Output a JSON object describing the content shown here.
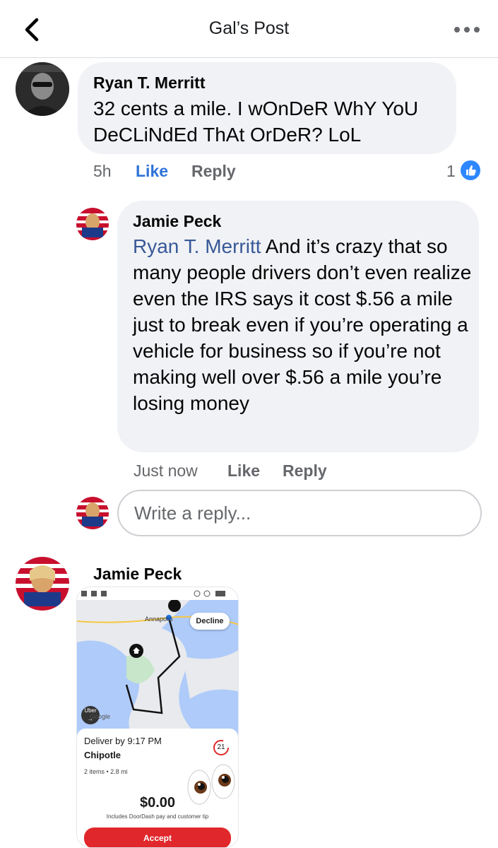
{
  "header": {
    "title": "Gal’s Post"
  },
  "comments": [
    {
      "author": "Ryan T. Merritt",
      "text": "32 cents a mile. I wOnDeR WhY YoU DeCLiNdEd ThAt OrDeR? LoL",
      "time": "5h",
      "like_label": "Like",
      "reply_label": "Reply",
      "reaction_count": "1",
      "liked": true
    },
    {
      "author": "Jamie Peck",
      "mention": "Ryan T. Merritt",
      "text": " And it’s crazy that so many people drivers don’t even realize even the IRS says it cost $.56 a mile just to break even if you’re operating a vehicle for business so if you’re not making well over $.56 a mile you’re losing money",
      "time": "Just now",
      "like_label": "Like",
      "reply_label": "Reply"
    },
    {
      "author": "Jamie Peck"
    }
  ],
  "reply_box": {
    "placeholder": "Write a reply..."
  },
  "attachment": {
    "map_label": "Annapolis",
    "decline_label": "Decline",
    "uber_label": "Uber",
    "map_brand": "Google",
    "deliver_by": "Deliver by 9:17 PM",
    "store": "Chipotle",
    "order_info": "2 items • 2.8 mi",
    "timer": "21",
    "pay": "$0.00",
    "pay_note": "Includes DoorDash pay and customer tip",
    "accept_label": "Accept"
  },
  "colors": {
    "link_blue": "#385898",
    "like_blue": "#2f73d8",
    "bubble_gray": "#f0f2f5",
    "accept_red": "#e0272b"
  }
}
